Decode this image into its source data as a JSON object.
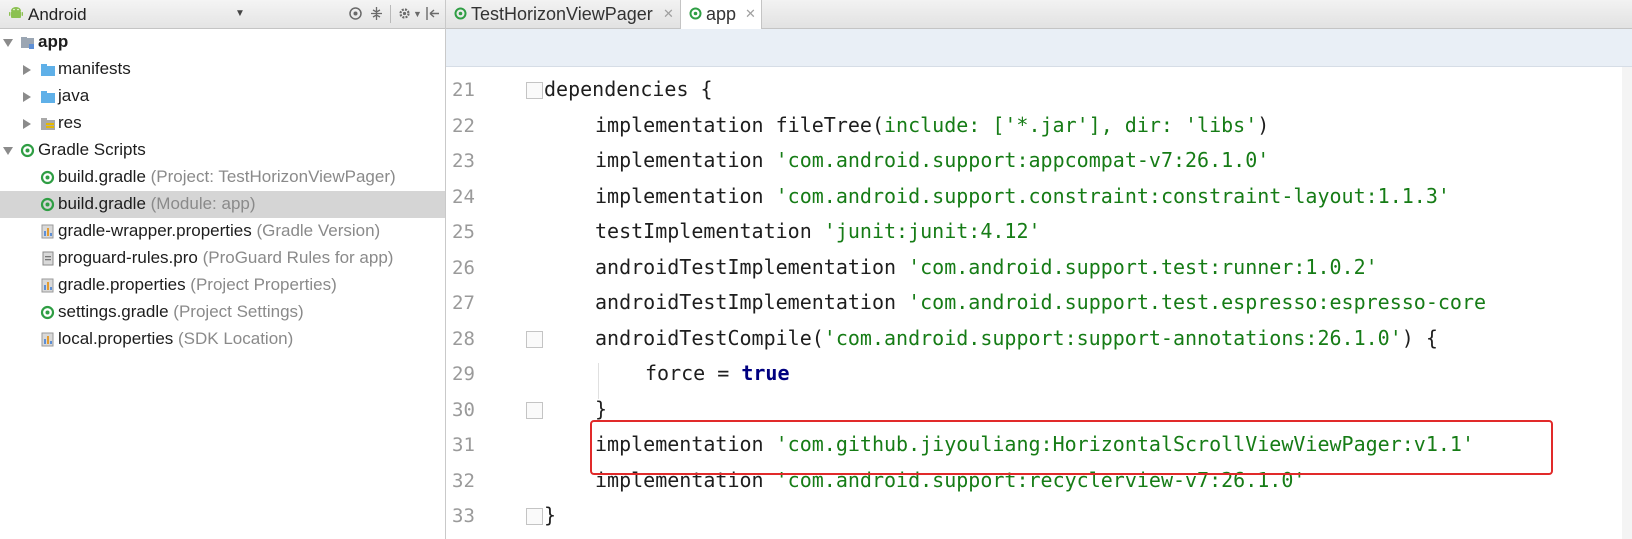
{
  "project_panel": {
    "view_mode": "Android",
    "tree": [
      {
        "label": "app",
        "hint": "",
        "level": 0,
        "expanded": true,
        "icon": "module-folder-icon"
      },
      {
        "label": "manifests",
        "hint": "",
        "level": 1,
        "expanded": false,
        "icon": "folder-icon"
      },
      {
        "label": "java",
        "hint": "",
        "level": 1,
        "expanded": false,
        "icon": "folder-icon"
      },
      {
        "label": "res",
        "hint": "",
        "level": 1,
        "expanded": false,
        "icon": "res-folder-icon"
      },
      {
        "label": "Gradle Scripts",
        "hint": "",
        "level": 0,
        "expanded": true,
        "icon": "gradle-icon"
      },
      {
        "label": "build.gradle",
        "hint": "(Project: TestHorizonViewPager)",
        "level": 1,
        "icon": "gradle-icon"
      },
      {
        "label": "build.gradle",
        "hint": "(Module: app)",
        "level": 1,
        "icon": "gradle-icon",
        "selected": true
      },
      {
        "label": "gradle-wrapper.properties",
        "hint": "(Gradle Version)",
        "level": 1,
        "icon": "properties-icon"
      },
      {
        "label": "proguard-rules.pro",
        "hint": "(ProGuard Rules for app)",
        "level": 1,
        "icon": "file-icon"
      },
      {
        "label": "gradle.properties",
        "hint": "(Project Properties)",
        "level": 1,
        "icon": "properties-icon"
      },
      {
        "label": "settings.gradle",
        "hint": "(Project Settings)",
        "level": 1,
        "icon": "gradle-icon"
      },
      {
        "label": "local.properties",
        "hint": "(SDK Location)",
        "level": 1,
        "icon": "properties-icon"
      }
    ]
  },
  "tabs": [
    {
      "label": "TestHorizonViewPager",
      "active": false
    },
    {
      "label": "app",
      "active": true
    }
  ],
  "editor": {
    "lines": [
      {
        "n": "21",
        "indent": 0,
        "parts": [
          [
            "plain",
            "dependencies {"
          ]
        ]
      },
      {
        "n": "22",
        "indent": 1,
        "parts": [
          [
            "plain",
            "implementation fileTree("
          ],
          [
            "str",
            "include: ['*.jar'], dir: 'libs'"
          ],
          [
            "plain",
            ")"
          ]
        ]
      },
      {
        "n": "23",
        "indent": 1,
        "parts": [
          [
            "plain",
            "implementation "
          ],
          [
            "str",
            "'com.android.support:appcompat-v7:26.1.0'"
          ]
        ]
      },
      {
        "n": "24",
        "indent": 1,
        "parts": [
          [
            "plain",
            "implementation "
          ],
          [
            "str",
            "'com.android.support.constraint:constraint-layout:1.1.3'"
          ]
        ]
      },
      {
        "n": "25",
        "indent": 1,
        "parts": [
          [
            "plain",
            "testImplementation "
          ],
          [
            "str",
            "'junit:junit:4.12'"
          ]
        ]
      },
      {
        "n": "26",
        "indent": 1,
        "parts": [
          [
            "plain",
            "androidTestImplementation "
          ],
          [
            "str",
            "'com.android.support.test:runner:1.0.2'"
          ]
        ]
      },
      {
        "n": "27",
        "indent": 1,
        "parts": [
          [
            "plain",
            "androidTestImplementation "
          ],
          [
            "str",
            "'com.android.support.test.espresso:espresso-core"
          ]
        ]
      },
      {
        "n": "28",
        "indent": 1,
        "parts": [
          [
            "plain",
            "androidTestCompile("
          ],
          [
            "str",
            "'com.android.support:support-annotations:26.1.0'"
          ],
          [
            "plain",
            ") {"
          ]
        ]
      },
      {
        "n": "29",
        "indent": 2,
        "parts": [
          [
            "plain",
            "force = "
          ],
          [
            "kw",
            "true"
          ]
        ]
      },
      {
        "n": "30",
        "indent": 1,
        "parts": [
          [
            "plain",
            "}"
          ]
        ]
      },
      {
        "n": "31",
        "indent": 1,
        "parts": [
          [
            "plain",
            "implementation "
          ],
          [
            "str",
            "'com.github.jiyouliang:HorizontalScrollViewViewPager:v1.1'"
          ]
        ]
      },
      {
        "n": "32",
        "indent": 1,
        "parts": [
          [
            "plain",
            "implementation "
          ],
          [
            "str",
            "'com.android.support:recyclerview-v7:26.1.0'"
          ]
        ]
      },
      {
        "n": "33",
        "indent": 0,
        "parts": [
          [
            "plain",
            "}"
          ]
        ]
      }
    ],
    "highlighted_line": "31"
  },
  "colors": {
    "string": "#167c16",
    "keyword": "#000080",
    "highlight_border": "#e12a2a",
    "selection": "#d5d5d5"
  }
}
